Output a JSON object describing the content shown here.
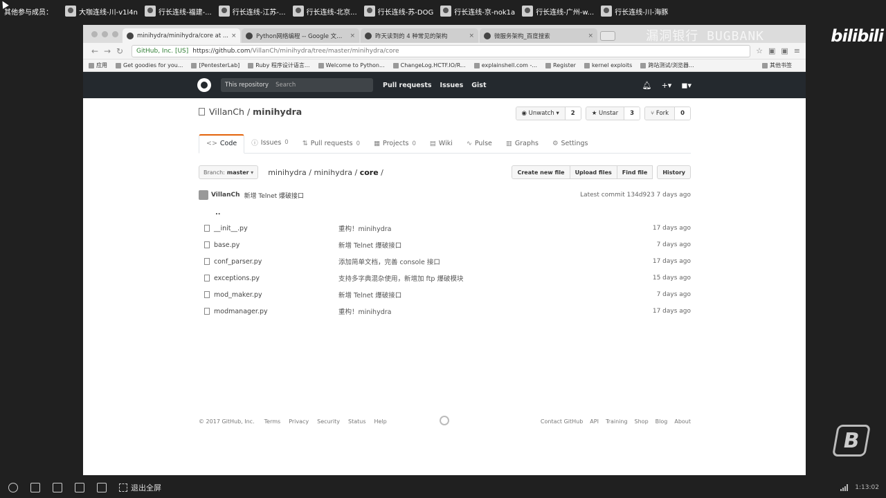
{
  "participants": {
    "label": "其他参与成员：",
    "items": [
      "大咖连线-川-v1l4n",
      "行长连线-福建-...",
      "行长连线-江苏-...",
      "行长连线-北京...",
      "行长连线-苏-DOG",
      "行长连线-京-nok1a",
      "行长连线-广州-w...",
      "行长连线-川-海豚"
    ]
  },
  "browser": {
    "tabs": [
      "minihydra/minihydra/core at ...",
      "Python网络编程 -- Google 文...",
      "昨天读到的 4 种常见的架构",
      "微服务架构_百度搜索"
    ],
    "watermark": "漏洞银行 BUGBANK",
    "address": {
      "secure_label": "GitHub, Inc. [US]",
      "url_host": "https://github.com",
      "url_path": "/VillanCh/minihydra/tree/master/minihydra/core"
    },
    "bookmarks": [
      "应用",
      "Get goodies for you...",
      "[PentesterLab]",
      "Ruby 程序设计语言...",
      "Welcome to Python...",
      "ChangeLog.HCTF.IO/R...",
      "explainshell.com -...",
      "Register",
      "kernel exploits",
      "跨站测试/浏览器..."
    ],
    "bookmarks_other": "其他书签"
  },
  "github": {
    "search_scope": "This repository",
    "search_placeholder": "Search",
    "nav": [
      "Pull requests",
      "Issues",
      "Gist"
    ],
    "repo": {
      "owner": "VillanCh",
      "sep": "/",
      "name": "minihydra"
    },
    "actions": [
      {
        "label": "Unwatch",
        "count": "2"
      },
      {
        "label": "Unstar",
        "count": "3"
      },
      {
        "label": "Fork",
        "count": "0"
      }
    ],
    "tabs": [
      {
        "icon": "<>",
        "label": "Code",
        "count": ""
      },
      {
        "icon": "ⓘ",
        "label": "Issues",
        "count": "0"
      },
      {
        "icon": "⇅",
        "label": "Pull requests",
        "count": "0"
      },
      {
        "icon": "▦",
        "label": "Projects",
        "count": "0"
      },
      {
        "icon": "▤",
        "label": "Wiki",
        "count": ""
      },
      {
        "icon": "∿",
        "label": "Pulse",
        "count": ""
      },
      {
        "icon": "▥",
        "label": "Graphs",
        "count": ""
      },
      {
        "icon": "⚙",
        "label": "Settings",
        "count": ""
      }
    ],
    "branch_label": "Branch:",
    "branch": "master",
    "breadcrumb_parts": [
      "minihydra",
      "/",
      "minihydra",
      "/"
    ],
    "breadcrumb_final": "core",
    "breadcrumb_trail": "/",
    "file_buttons": [
      "Create new file",
      "Upload files",
      "Find file",
      "History"
    ],
    "commit": {
      "author": "VillanCh",
      "message": "新增 Telnet 爆破接口",
      "latest": "Latest commit 134d923 7 days ago"
    },
    "updir": "..",
    "files": [
      {
        "name": "__init__.py",
        "message": "重构！minihydra",
        "age": "17 days ago"
      },
      {
        "name": "base.py",
        "message": "新增 Telnet 爆破接口",
        "age": "7 days ago"
      },
      {
        "name": "conf_parser.py",
        "message": "添加简单文档，完善 console 接口",
        "age": "17 days ago"
      },
      {
        "name": "exceptions.py",
        "message": "支持多字典混杂使用，新增加 ftp 爆破模块",
        "age": "15 days ago"
      },
      {
        "name": "mod_maker.py",
        "message": "新增 Telnet 爆破接口",
        "age": "7 days ago"
      },
      {
        "name": "modmanager.py",
        "message": "重构！minihydra",
        "age": "17 days ago"
      }
    ],
    "footer_left": [
      "© 2017 GitHub, Inc.",
      "Terms",
      "Privacy",
      "Security",
      "Status",
      "Help"
    ],
    "footer_right": [
      "Contact GitHub",
      "API",
      "Training",
      "Shop",
      "Blog",
      "About"
    ]
  },
  "toolbar": {
    "exit_label": "退出全屏",
    "time": "1:13:02"
  },
  "brand": {
    "bili": "bilibili"
  }
}
